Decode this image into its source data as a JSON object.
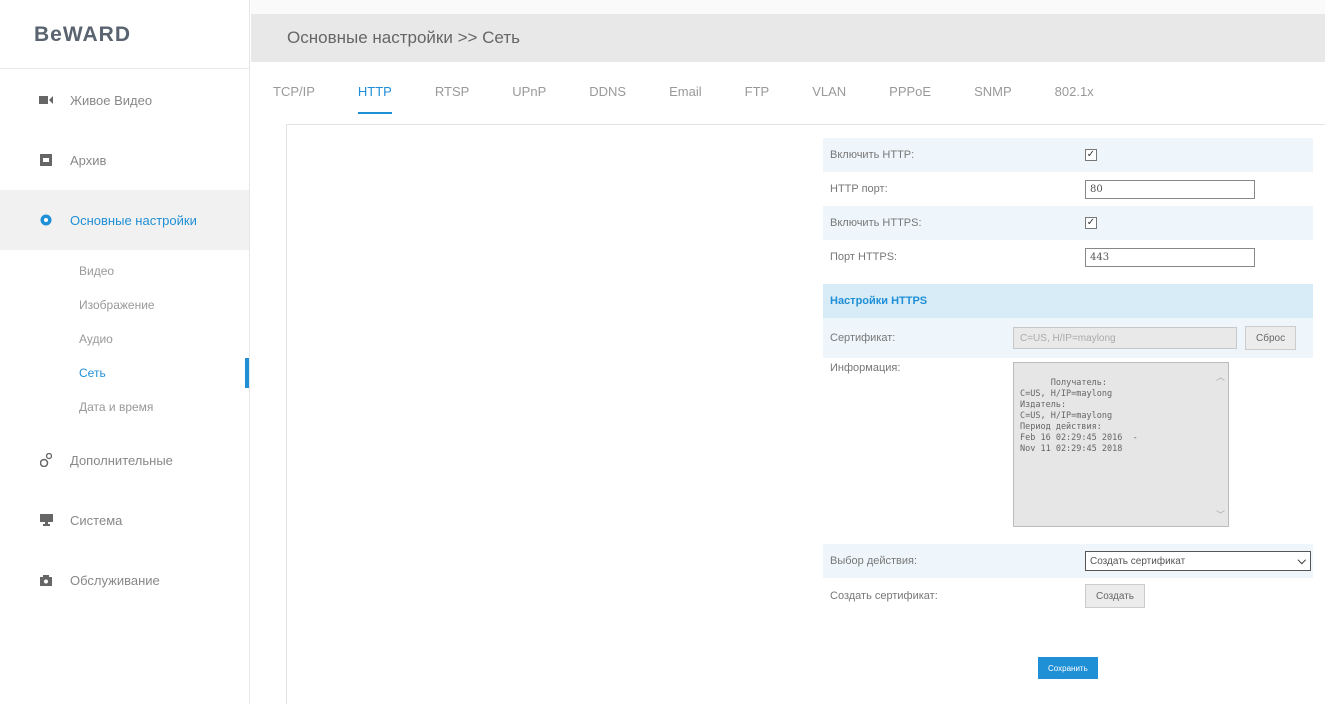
{
  "brand": {
    "logo_text": "BeWARD"
  },
  "sidebar": {
    "items": [
      {
        "label": "Живое Видео",
        "icon": "video-camera-icon"
      },
      {
        "label": "Архив",
        "icon": "archive-icon"
      },
      {
        "label": "Основные настройки",
        "icon": "gear-icon"
      },
      {
        "label": "Дополнительные",
        "icon": "gears-icon"
      },
      {
        "label": "Система",
        "icon": "monitor-icon"
      },
      {
        "label": "Обслуживание",
        "icon": "maintenance-icon"
      }
    ],
    "sub_items": [
      {
        "label": "Видео"
      },
      {
        "label": "Изображение"
      },
      {
        "label": "Аудио"
      },
      {
        "label": "Сеть"
      },
      {
        "label": "Дата и время"
      }
    ]
  },
  "header": {
    "breadcrumb": "Основные настройки >> Сеть"
  },
  "tabs": [
    {
      "label": "TCP/IP"
    },
    {
      "label": "HTTP"
    },
    {
      "label": "RTSP"
    },
    {
      "label": "UPnP"
    },
    {
      "label": "DDNS"
    },
    {
      "label": "Email"
    },
    {
      "label": "FTP"
    },
    {
      "label": "VLAN"
    },
    {
      "label": "PPPoE"
    },
    {
      "label": "SNMP"
    },
    {
      "label": "802.1x"
    }
  ],
  "form": {
    "enable_http_label": "Включить HTTP:",
    "enable_http_checked": true,
    "http_port_label": "HTTP порт:",
    "http_port_value": "80",
    "enable_https_label": "Включить HTTPS:",
    "enable_https_checked": true,
    "https_port_label": "Порт HTTPS:",
    "https_port_value": "443",
    "section_title": "Настройки HTTPS",
    "certificate_label": "Сертификат:",
    "certificate_value": "C=US, H/IP=maylong",
    "reset_button": "Сброс",
    "info_label": "Информация:",
    "info_text": "Получатель:\nC=US, H/IP=maylong\nИздатель:\nC=US, H/IP=maylong\nПериод действия:\nFeb 16 02:29:45 2016  -\nNov 11 02:29:45 2018",
    "action_label": "Выбор действия:",
    "action_selected": "Создать сертификат",
    "create_label": "Создать сертификат:",
    "create_button": "Создать",
    "save_button": "Сохранить"
  },
  "colors": {
    "accent": "#1f8fd6",
    "header_bg": "#e8e8e8",
    "row_shade": "#eef6fb",
    "section_bg": "#d8ecf8"
  }
}
